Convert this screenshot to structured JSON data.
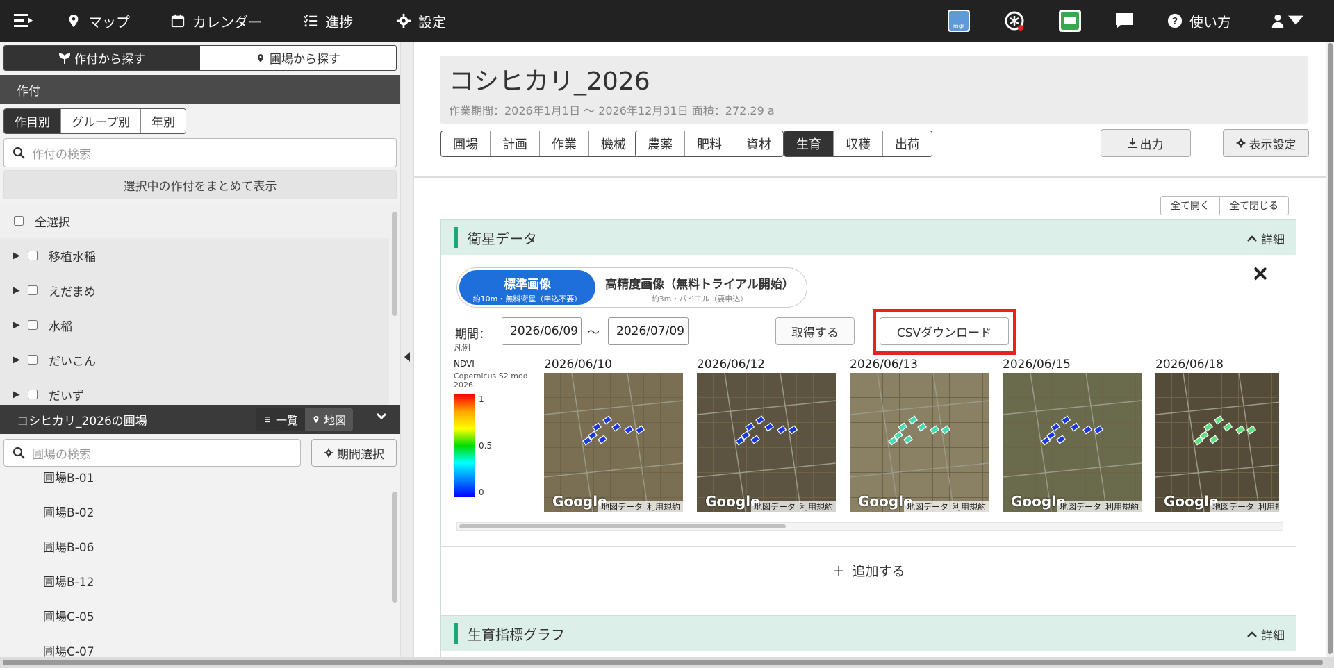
{
  "topbar": {
    "nav": [
      {
        "label": "マップ",
        "icon": "map-pin-icon"
      },
      {
        "label": "カレンダー",
        "icon": "calendar-icon"
      },
      {
        "label": "進捗",
        "icon": "checklist-icon"
      },
      {
        "label": "設定",
        "icon": "gear-icon"
      }
    ],
    "mgr_badge": "mgr",
    "help_label": "使い方"
  },
  "left": {
    "search_mode_tabs": [
      "作付から探す",
      "圃場から探す"
    ],
    "crop_section_title": "作付",
    "crop_tabs": [
      "作目別",
      "グループ別",
      "年別"
    ],
    "crop_search_placeholder": "作付の検索",
    "show_selected_label": "選択中の作付をまとめて表示",
    "select_all_label": "全選択",
    "crops": [
      "移植水稲",
      "えだまめ",
      "水稲",
      "だいこん",
      "だいず"
    ],
    "field_section_title": "コシヒカリ_2026の圃場",
    "view_list_label": "一覧",
    "view_map_label": "地図",
    "field_search_placeholder": "圃場の検索",
    "period_select_label": "期間選択",
    "fields": [
      "圃場B-01",
      "圃場B-02",
      "圃場B-06",
      "圃場B-12",
      "圃場C-05",
      "圃場C-07"
    ]
  },
  "main": {
    "title": "コシヒカリ_2026",
    "subtitle": "作業期間：2026年1月1日 〜 2026年12月31日  面積：272.29 a",
    "tab_groups": [
      [
        "圃場",
        "計画",
        "作業",
        "機械"
      ],
      [
        "農薬",
        "肥料",
        "資材"
      ],
      [
        "生育",
        "収穫",
        "出荷"
      ]
    ],
    "active_tab": "生育",
    "export_label": "出力",
    "display_settings_label": "表示設定",
    "expand_all_label": "全て開く",
    "collapse_all_label": "全て閉じる",
    "detail_label": "詳細",
    "satellite": {
      "title": "衛星データ",
      "standard_label": "標準画像",
      "standard_sub": "約10m・無料衛星（申込不要）",
      "hires_label": "高精度画像（無料トライアル開始）",
      "hires_sub": "約3m・パイエル（要申込）",
      "period_label": "期間：",
      "date_from": "2026/06/09",
      "tilde": "〜",
      "date_to": "2026/07/09",
      "fetch_label": "取得する",
      "csv_label": "CSVダウンロード",
      "legend": {
        "title": "凡例",
        "index": "NDVI",
        "source": "Copernicus S2 mod 2026",
        "ticks": [
          "1",
          "0.5",
          "0"
        ]
      },
      "images": [
        {
          "date": "2026/06/10",
          "color": "#1a37e6"
        },
        {
          "date": "2026/06/12",
          "color": "#1a37e6"
        },
        {
          "date": "2026/06/13",
          "color": "#3fe0b0"
        },
        {
          "date": "2026/06/15",
          "color": "#1a37e6"
        },
        {
          "date": "2026/06/18",
          "color": "#5be07a"
        }
      ],
      "google_label": "Google",
      "map_data_label": "地図データ",
      "terms_label": "利用規約",
      "add_label": "追加する"
    },
    "growth_graph_title": "生育指標グラフ"
  },
  "colors": {
    "accent_green": "#1fa57a",
    "primary_blue": "#1e6fd9",
    "highlight_red": "#e8231f"
  }
}
